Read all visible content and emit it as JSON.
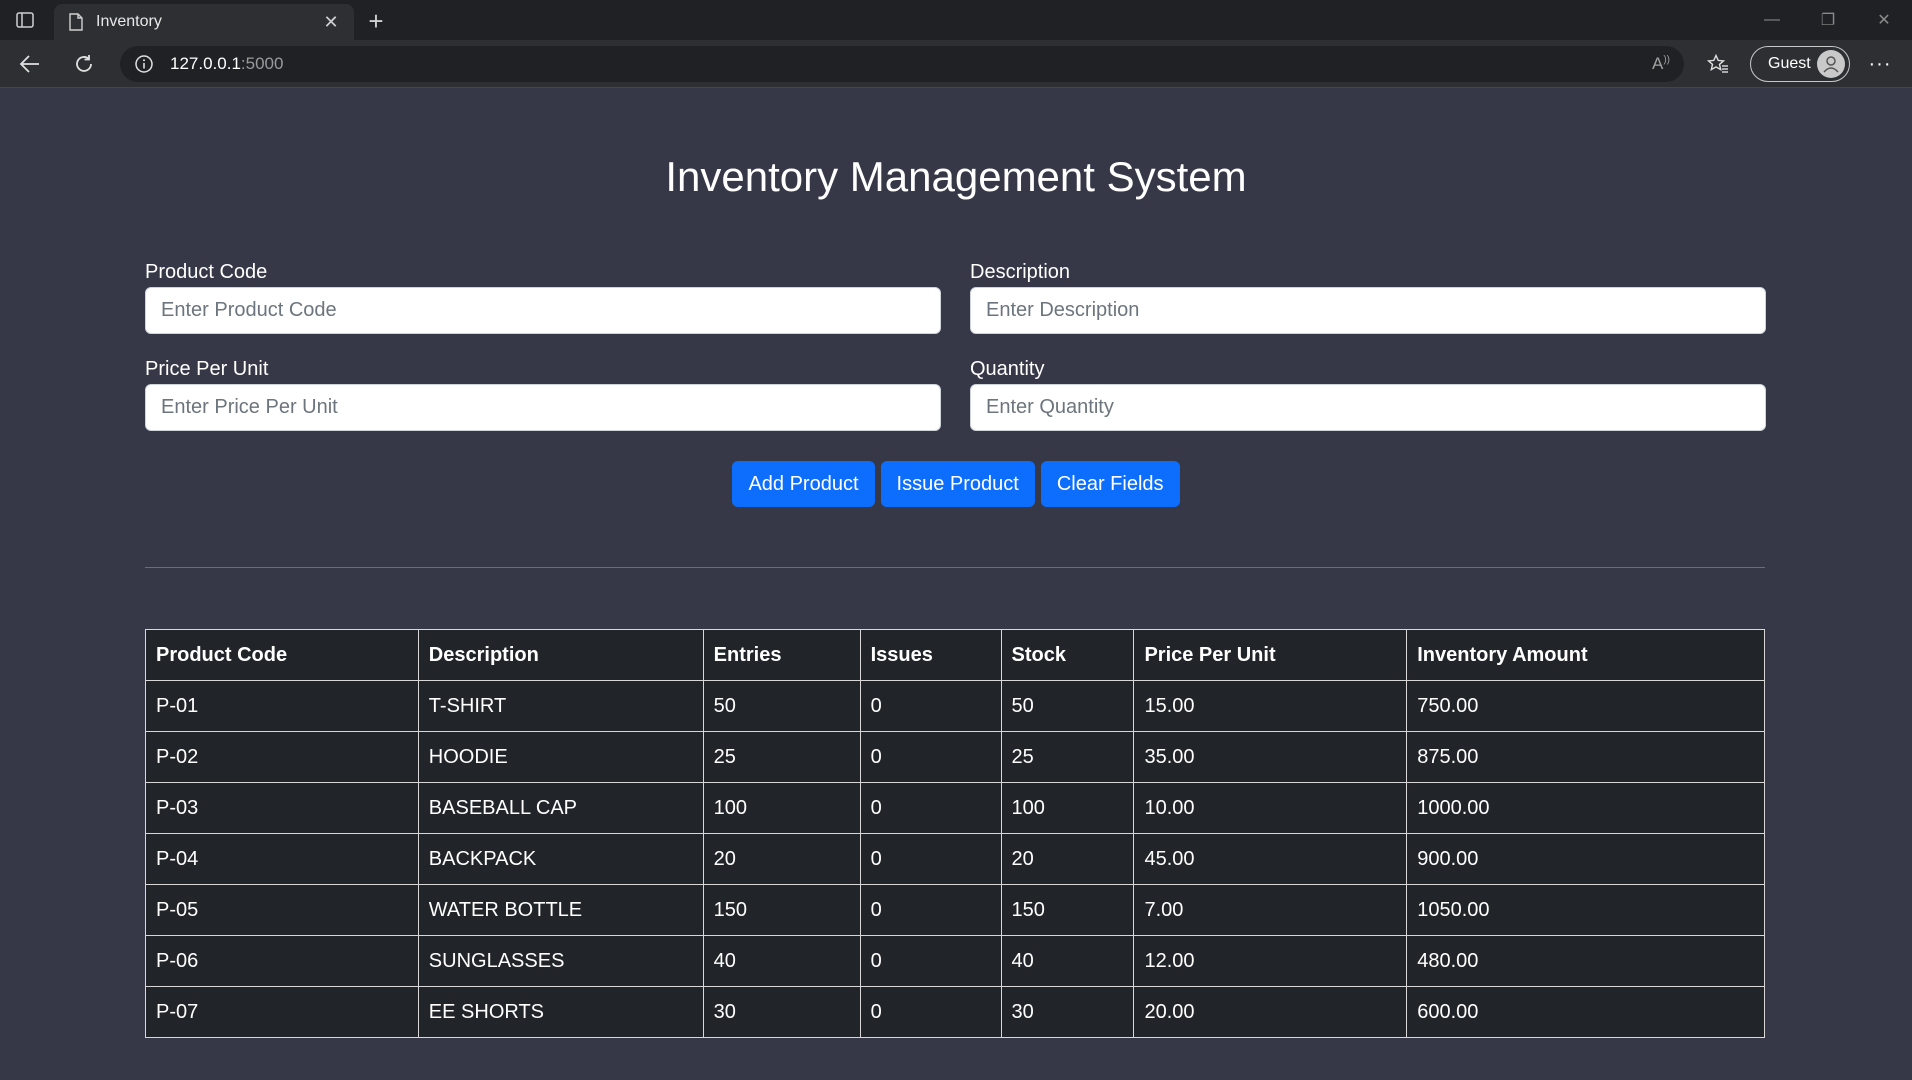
{
  "browser": {
    "tab_title": "Inventory",
    "url_host": "127.0.0.1",
    "url_port": ":5000",
    "profile_label": "Guest"
  },
  "page": {
    "title": "Inventory Management System"
  },
  "form": {
    "product_code": {
      "label": "Product Code",
      "placeholder": "Enter Product Code",
      "value": ""
    },
    "description": {
      "label": "Description",
      "placeholder": "Enter Description",
      "value": ""
    },
    "price_per_unit": {
      "label": "Price Per Unit",
      "placeholder": "Enter Price Per Unit",
      "value": ""
    },
    "quantity": {
      "label": "Quantity",
      "placeholder": "Enter Quantity",
      "value": ""
    }
  },
  "buttons": {
    "add": "Add Product",
    "issue": "Issue Product",
    "clear": "Clear Fields"
  },
  "table": {
    "columns": [
      "Product Code",
      "Description",
      "Entries",
      "Issues",
      "Stock",
      "Price Per Unit",
      "Inventory Amount"
    ],
    "rows": [
      [
        "P-01",
        "T-SHIRT",
        "50",
        "0",
        "50",
        "15.00",
        "750.00"
      ],
      [
        "P-02",
        "HOODIE",
        "25",
        "0",
        "25",
        "35.00",
        "875.00"
      ],
      [
        "P-03",
        "BASEBALL CAP",
        "100",
        "0",
        "100",
        "10.00",
        "1000.00"
      ],
      [
        "P-04",
        "BACKPACK",
        "20",
        "0",
        "20",
        "45.00",
        "900.00"
      ],
      [
        "P-05",
        "WATER BOTTLE",
        "150",
        "0",
        "150",
        "7.00",
        "1050.00"
      ],
      [
        "P-06",
        "SUNGLASSES",
        "40",
        "0",
        "40",
        "12.00",
        "480.00"
      ],
      [
        "P-07",
        "EE SHORTS",
        "30",
        "0",
        "30",
        "20.00",
        "600.00"
      ]
    ]
  },
  "colors": {
    "page_background": "#363848",
    "primary_button": "#0d6efd",
    "table_background": "#212529"
  }
}
